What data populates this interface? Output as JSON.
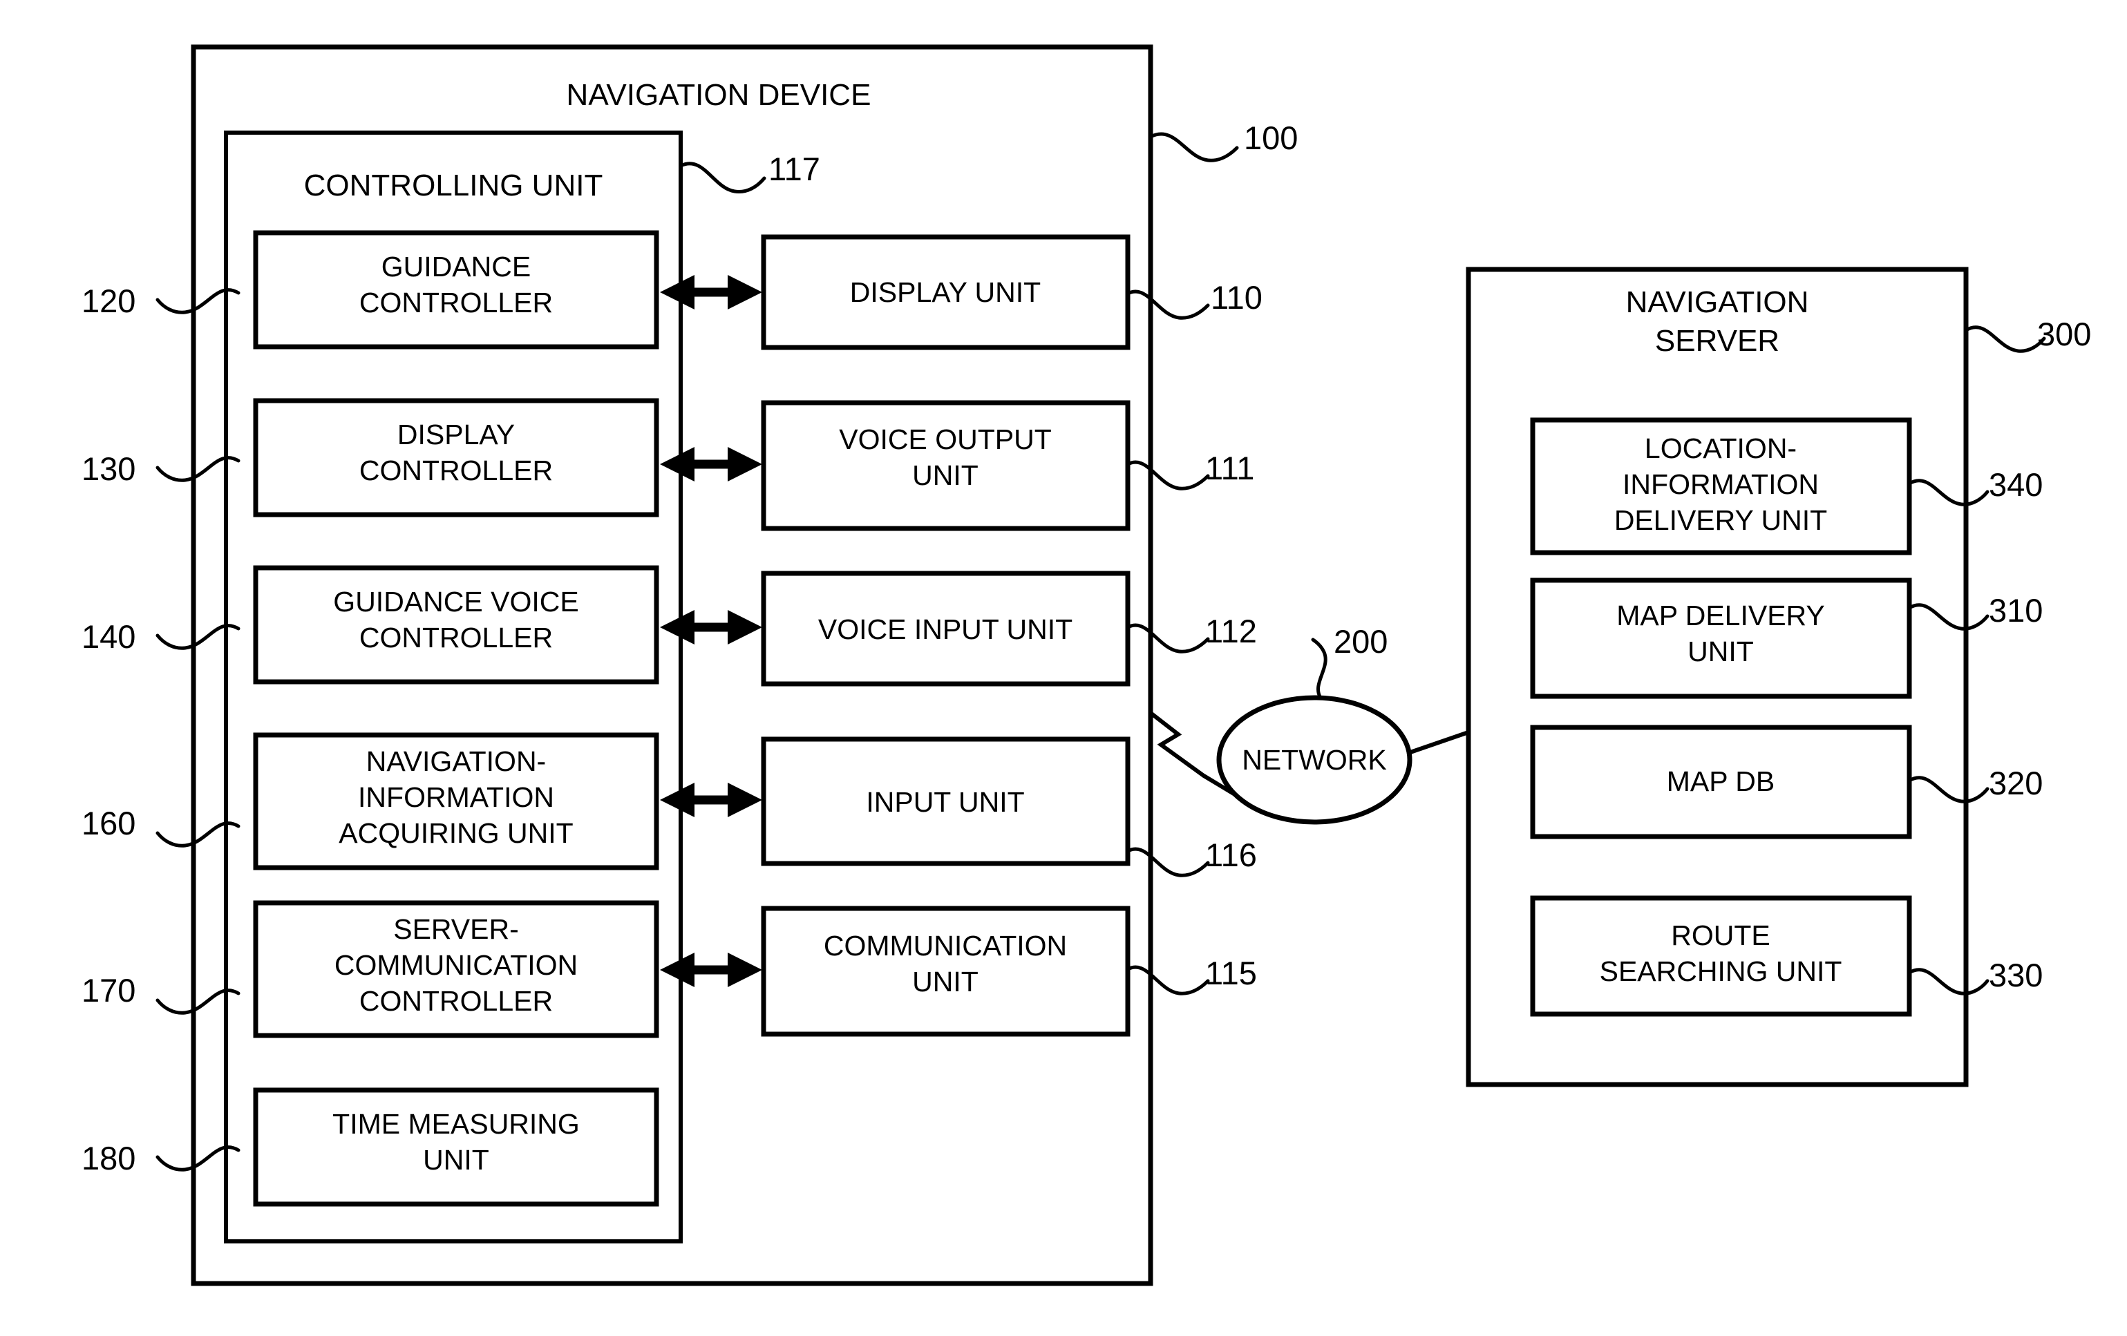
{
  "figure": {
    "background_color": "#ffffff",
    "line_color": "#000000"
  },
  "navigation_device": {
    "title": "NAVIGATION DEVICE",
    "ref": "100",
    "controlling_unit": {
      "title": "CONTROLLING UNIT",
      "ref": "117",
      "modules": [
        {
          "ref": "120",
          "label_line1": "GUIDANCE",
          "label_line2": "CONTROLLER",
          "label_line3": ""
        },
        {
          "ref": "130",
          "label_line1": "DISPLAY",
          "label_line2": "CONTROLLER",
          "label_line3": ""
        },
        {
          "ref": "140",
          "label_line1": "GUIDANCE VOICE",
          "label_line2": "CONTROLLER",
          "label_line3": ""
        },
        {
          "ref": "160",
          "label_line1": "NAVIGATION-",
          "label_line2": "INFORMATION",
          "label_line3": "ACQUIRING UNIT"
        },
        {
          "ref": "170",
          "label_line1": "SERVER-",
          "label_line2": "COMMUNICATION",
          "label_line3": "CONTROLLER"
        },
        {
          "ref": "180",
          "label_line1": "TIME MEASURING",
          "label_line2": "UNIT",
          "label_line3": ""
        }
      ]
    },
    "io_units": [
      {
        "ref": "110",
        "label_line1": "DISPLAY UNIT",
        "label_line2": ""
      },
      {
        "ref": "111",
        "label_line1": "VOICE OUTPUT",
        "label_line2": "UNIT"
      },
      {
        "ref": "112",
        "label_line1": "VOICE INPUT UNIT",
        "label_line2": ""
      },
      {
        "ref": "116",
        "label_line1": "INPUT UNIT",
        "label_line2": ""
      },
      {
        "ref": "115",
        "label_line1": "COMMUNICATION",
        "label_line2": "UNIT"
      }
    ]
  },
  "network": {
    "label": "NETWORK",
    "ref": "200"
  },
  "navigation_server": {
    "title_line1": "NAVIGATION",
    "title_line2": "SERVER",
    "ref": "300",
    "modules": [
      {
        "ref": "340",
        "label_line1": "LOCATION-",
        "label_line2": "INFORMATION",
        "label_line3": "DELIVERY UNIT"
      },
      {
        "ref": "310",
        "label_line1": "MAP DELIVERY",
        "label_line2": "UNIT",
        "label_line3": ""
      },
      {
        "ref": "320",
        "label_line1": "MAP DB",
        "label_line2": "",
        "label_line3": ""
      },
      {
        "ref": "330",
        "label_line1": "ROUTE",
        "label_line2": "SEARCHING UNIT",
        "label_line3": ""
      }
    ]
  }
}
